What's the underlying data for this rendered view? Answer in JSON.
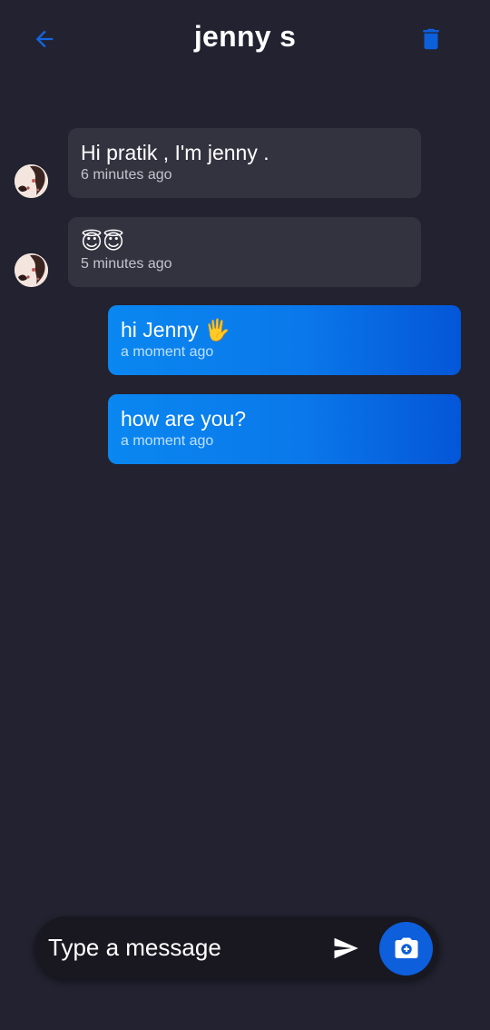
{
  "header": {
    "title": "jenny s",
    "back_icon": "arrow-back-icon",
    "delete_icon": "trash-icon"
  },
  "colors": {
    "background": "#222230",
    "incoming_bubble": "#33323f",
    "outgoing_gradient_start": "#0a87f0",
    "outgoing_gradient_end": "#0456d8",
    "accent": "#0d5fdc"
  },
  "messages": [
    {
      "direction": "incoming",
      "text": "Hi pratik , I'm jenny .",
      "time": "6 minutes ago"
    },
    {
      "direction": "incoming",
      "text": "😇😇",
      "time": "5 minutes ago"
    },
    {
      "direction": "outgoing",
      "text": "hi Jenny 🖐",
      "time": "a moment ago"
    },
    {
      "direction": "outgoing",
      "text": "how are you?",
      "time": "a moment ago"
    }
  ],
  "composer": {
    "placeholder": "Type a message",
    "send_icon": "send-icon",
    "camera_icon": "camera-icon"
  }
}
